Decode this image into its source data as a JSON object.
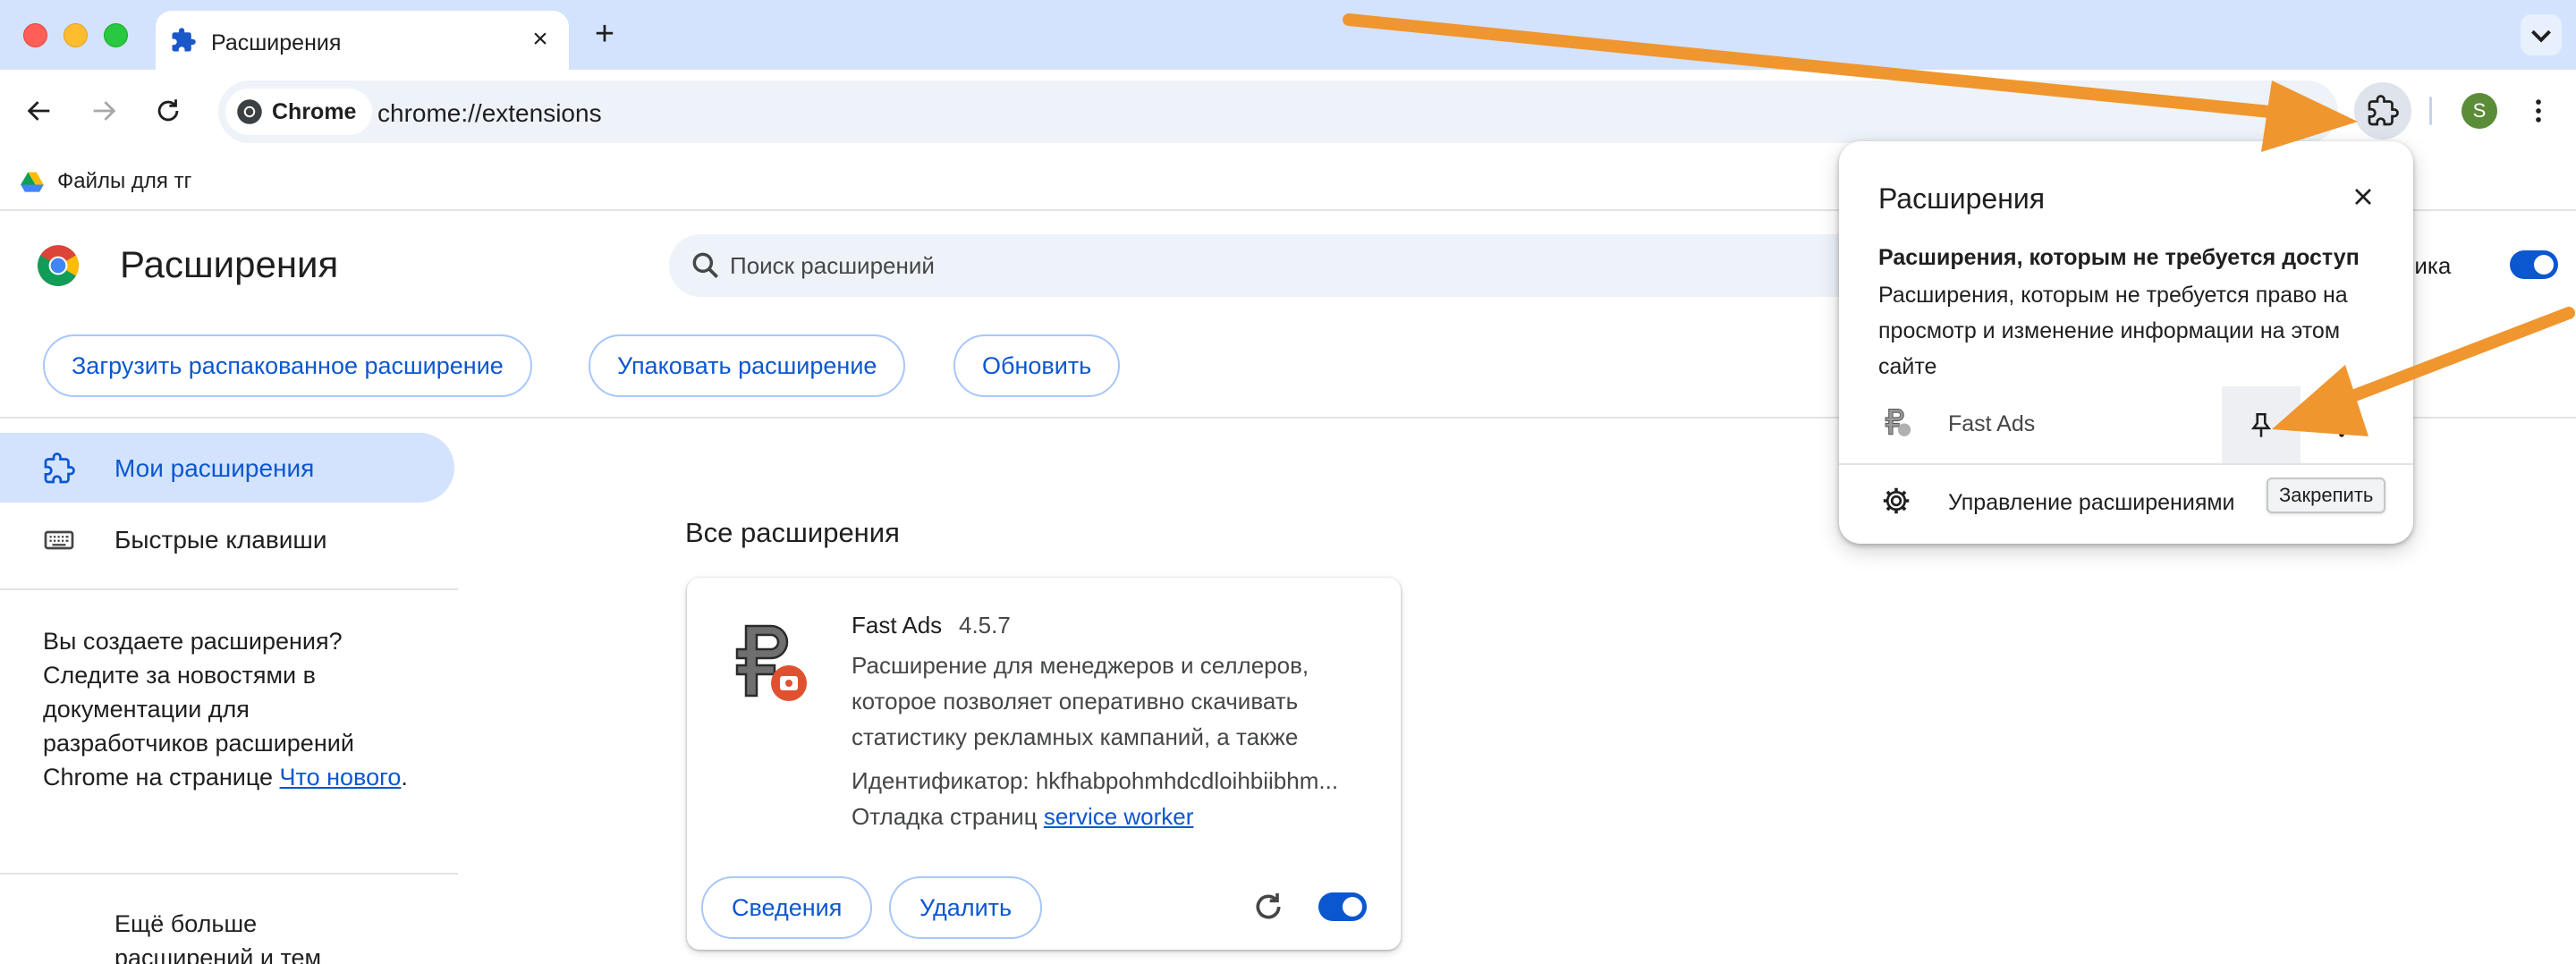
{
  "browser": {
    "tab": {
      "title": "Расширения",
      "icon": "puzzle-icon"
    },
    "omnibox": {
      "chip_label": "Chrome",
      "url": "chrome://extensions"
    },
    "profile_initial": "S",
    "bookmarks": [
      {
        "label": "Файлы для тг",
        "icon": "google-drive-icon"
      }
    ]
  },
  "page": {
    "title": "Расширения",
    "search_placeholder": "Поиск расширений",
    "dev_mode_label": "отчика",
    "toolbar_buttons": {
      "load_unpacked": "Загрузить распакованное расширение",
      "pack": "Упаковать расширение",
      "update": "Обновить"
    }
  },
  "sidebar": {
    "items": [
      {
        "label": "Мои расширения",
        "icon": "puzzle-icon",
        "active": true
      },
      {
        "label": "Быстрые клавиши",
        "icon": "keyboard-icon",
        "active": false
      }
    ],
    "dev_promo": {
      "text": "Вы создаете расширения? Следите за новостями в документации для разработчиков расширений Chrome на странице ",
      "link": "Что нового",
      "suffix": "."
    },
    "more_promo": "Ещё больше расширений и тем"
  },
  "main": {
    "section_title": "Все расширения",
    "extensions": [
      {
        "name": "Fast Ads",
        "version": "4.5.7",
        "description": "Расширение для менеджеров и селлеров, которое позволяет оперативно скачивать статистику рекламных кампаний, а также",
        "id_label": "Идентификатор: hkfhabpohmhdcdloihbiibhm...",
        "inspect_label": "Отладка страниц ",
        "inspect_link": "service worker",
        "details_label": "Сведения",
        "remove_label": "Удалить",
        "enabled": true
      }
    ]
  },
  "popup": {
    "title": "Расширения",
    "subheading": "Расширения, которым не требуется доступ",
    "description": "Расширения, которым не требуется право на просмотр и изменение информации на этом сайте",
    "items": [
      {
        "name": "Fast Ads"
      }
    ],
    "manage_label": "Управление расширениями",
    "tooltip": "Закрепить"
  },
  "colors": {
    "accent": "#0b57d0",
    "tabstrip": "#d3e3fd",
    "annotation_arrow": "#f0962f"
  }
}
